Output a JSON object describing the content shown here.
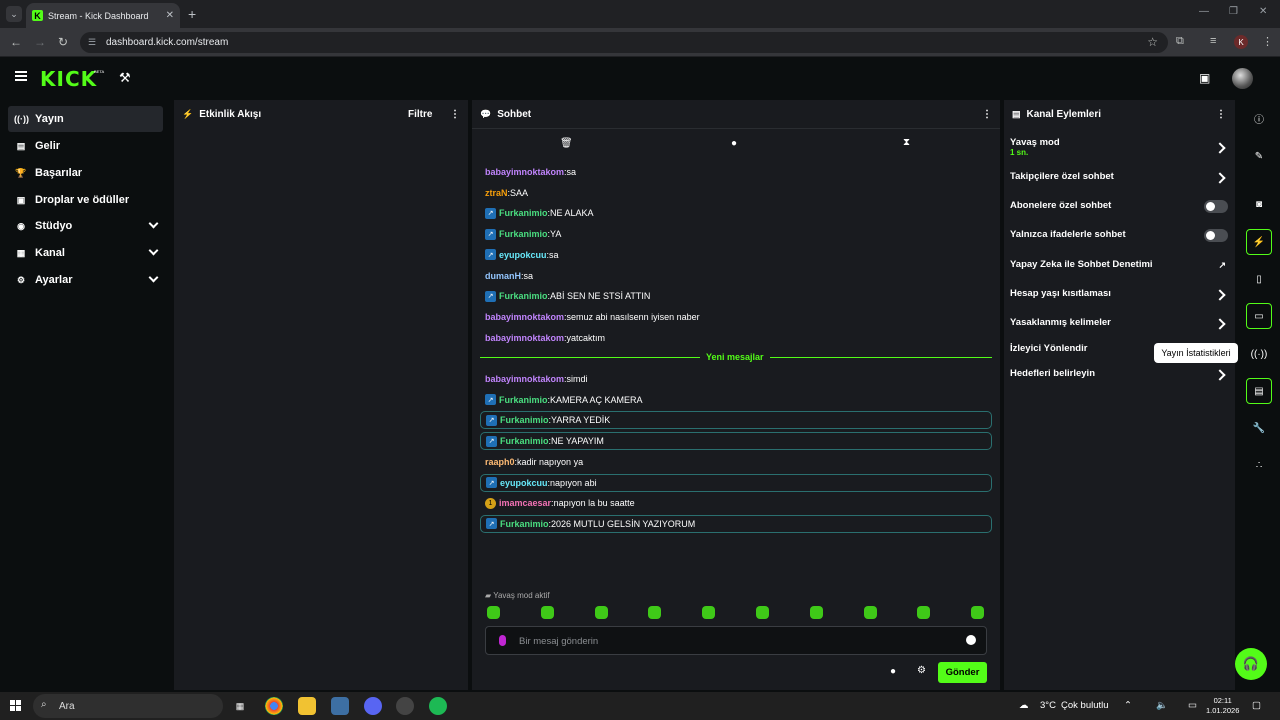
{
  "browser": {
    "tab_title": "Stream - Kick Dashboard",
    "tab_close": "✕",
    "new_tab": "+",
    "url": "dashboard.kick.com/stream",
    "profile_initial": "K"
  },
  "header": {
    "logo": "KICK",
    "beta": "BETA"
  },
  "sidebar": {
    "items": [
      {
        "label": "Yayın",
        "icon": "broadcast-icon",
        "glyph": "((·))",
        "active": true
      },
      {
        "label": "Gelir",
        "icon": "chart-icon",
        "glyph": "▤"
      },
      {
        "label": "Başarılar",
        "icon": "trophy-icon",
        "glyph": "🏆"
      },
      {
        "label": "Droplar ve ödüller",
        "icon": "gift-icon",
        "glyph": "▣"
      },
      {
        "label": "Stüdyo",
        "icon": "studio-icon",
        "glyph": "◉"
      },
      {
        "label": "Kanal",
        "icon": "channel-icon",
        "glyph": "▦"
      },
      {
        "label": "Ayarlar",
        "icon": "gear-icon",
        "glyph": "⚙"
      }
    ]
  },
  "activity": {
    "title": "Etkinlik Akışı",
    "filter": "Filtre"
  },
  "chat": {
    "title": "Sohbet",
    "messages_before": [
      {
        "user": "babayimnoktakom",
        "text": "sa",
        "color": "#c084fc",
        "badge": false,
        "hl": false
      },
      {
        "user": "ztraN",
        "text": "SAA",
        "color": "#f59e0b",
        "badge": false,
        "hl": false
      },
      {
        "user": "Furkanimio",
        "text": "NE ALAKA",
        "color": "#4ade80",
        "badge": true,
        "hl": false
      },
      {
        "user": "Furkanimio",
        "text": "YA",
        "color": "#4ade80",
        "badge": true,
        "hl": false
      },
      {
        "user": "eyupokcuu",
        "text": "sa",
        "color": "#67e8f9",
        "badge": true,
        "hl": false
      },
      {
        "user": "dumanH",
        "text": "sa",
        "color": "#93c5fd",
        "badge": false,
        "hl": false
      },
      {
        "user": "Furkanimio",
        "text": "ABİ SEN NE STSİ ATTIN",
        "color": "#4ade80",
        "badge": true,
        "hl": false
      },
      {
        "user": "babayimnoktakom",
        "text": "semuz abi nasılsenn iyisen naber",
        "color": "#c084fc",
        "badge": false,
        "hl": false
      },
      {
        "user": "babayimnoktakom",
        "text": "yatcaktım",
        "color": "#c084fc",
        "badge": false,
        "hl": false
      }
    ],
    "new_messages": "Yeni mesajlar",
    "messages_after": [
      {
        "user": "babayimnoktakom",
        "text": "simdi",
        "color": "#c084fc",
        "badge": false,
        "hl": false
      },
      {
        "user": "Furkanimio",
        "text": "KAMERA AÇ KAMERA",
        "color": "#4ade80",
        "badge": true,
        "hl": false
      },
      {
        "user": "Furkanimio",
        "text": "YARRA YEDİK",
        "color": "#4ade80",
        "badge": true,
        "hl": true
      },
      {
        "user": "Furkanimio",
        "text": "NE YAPAYIM",
        "color": "#4ade80",
        "badge": true,
        "hl": true
      },
      {
        "user": "raaph0",
        "text": "kadir napıyon ya",
        "color": "#fdba74",
        "badge": false,
        "hl": false
      },
      {
        "user": "eyupokcuu",
        "text": "napıyon abi",
        "color": "#67e8f9",
        "badge": true,
        "hl": true
      },
      {
        "user": "imamcaesar",
        "text": "napıyon la bu saatte",
        "color": "#f472b6",
        "badge": "sub",
        "hl": false
      },
      {
        "user": "Furkanimio",
        "text": "2026 MUTLU GELSİN YAZIYORUM",
        "color": "#4ade80",
        "badge": true,
        "hl": true
      }
    ],
    "slow_mode": "Yavaş mod aktif",
    "input_placeholder": "Bir mesaj gönderin",
    "send": "Gönder"
  },
  "channel_actions": {
    "title": "Kanal Eylemleri",
    "items": [
      {
        "label": "Yavaş mod",
        "sub": "1 sn.",
        "control": "arrow"
      },
      {
        "label": "Takipçilere özel sohbet",
        "control": "arrow"
      },
      {
        "label": "Abonelere özel sohbet",
        "control": "toggle"
      },
      {
        "label": "Yalnızca ifadelerle sohbet",
        "control": "toggle"
      },
      {
        "label": "Yapay Zeka ile Sohbet Denetimi",
        "control": "external"
      },
      {
        "label": "Hesap yaşı kısıtlaması",
        "control": "arrow"
      },
      {
        "label": "Yasaklanmış kelimeler",
        "control": "arrow"
      },
      {
        "label": "İzleyici Yönlendir",
        "control": "none"
      },
      {
        "label": "Hedefleri belirleyin",
        "control": "arrow"
      }
    ]
  },
  "rail": {
    "tooltip": "Yayın İstatistikleri"
  },
  "taskbar": {
    "search": "Ara",
    "weather": "3°C",
    "weather_text": "Çok bulutlu",
    "time": "02:11",
    "date": "1.01.2026"
  }
}
